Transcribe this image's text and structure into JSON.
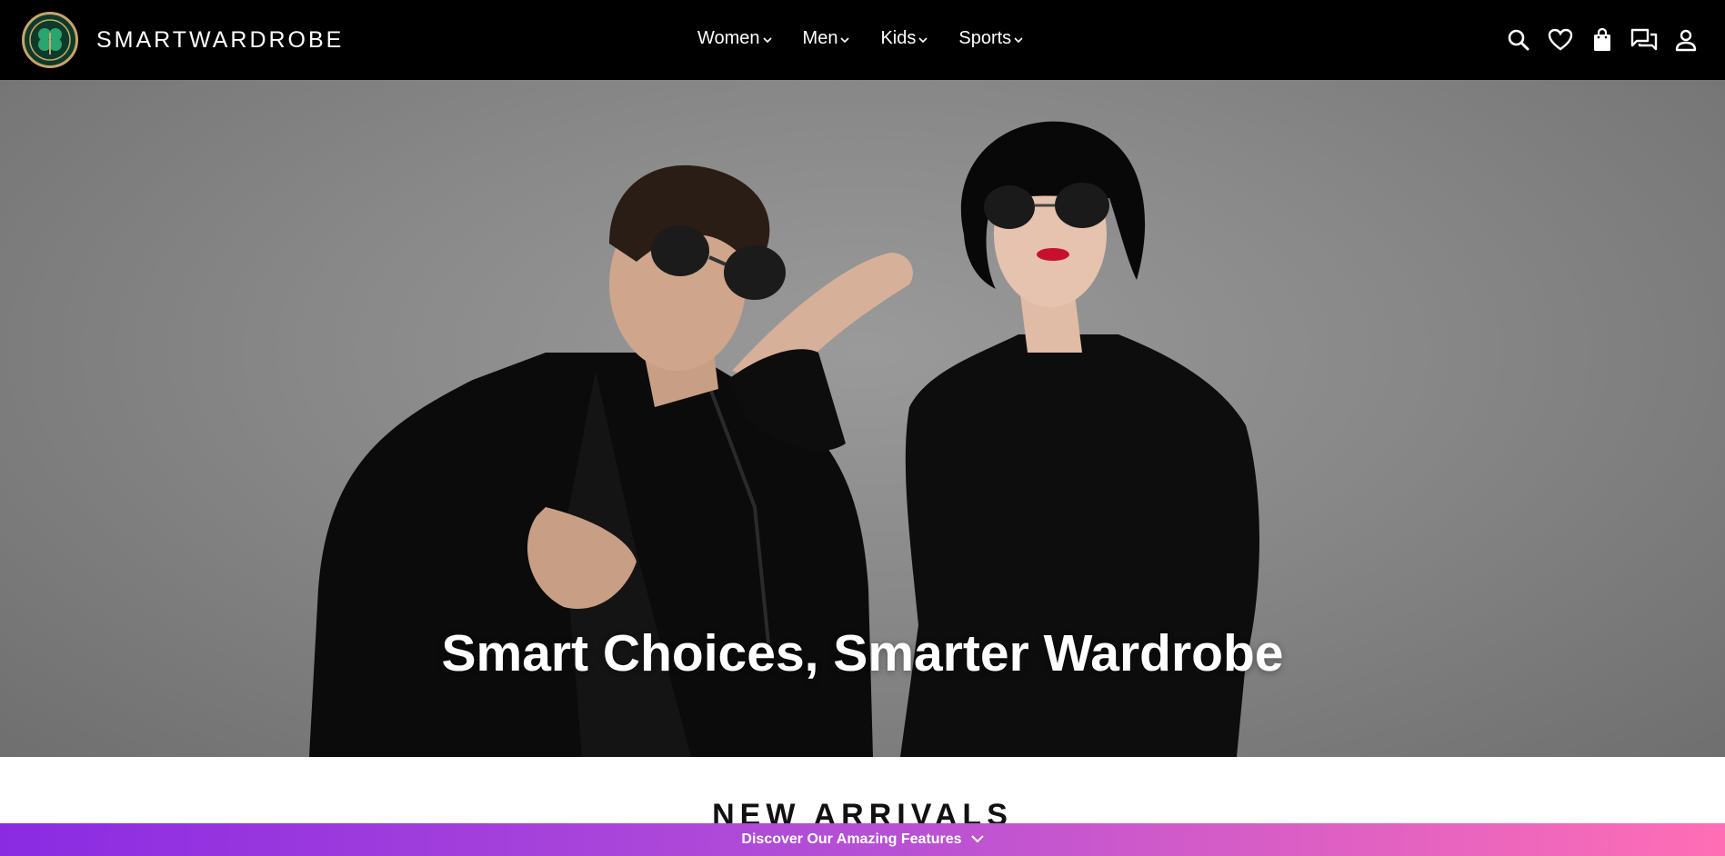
{
  "header": {
    "brand": "SMARTWARDROBE",
    "logo_icon": "clover-crest-logo",
    "nav": [
      {
        "label": "Women"
      },
      {
        "label": "Men"
      },
      {
        "label": "Kids"
      },
      {
        "label": "Sports"
      }
    ],
    "icons": [
      "search-icon",
      "heart-icon",
      "bag-icon",
      "chat-icon",
      "user-icon"
    ]
  },
  "hero": {
    "title": "Smart Choices, Smarter Wardrobe",
    "image": "hero-photo-couple-black-outfits-sunglasses"
  },
  "sections": {
    "new_arrivals_title": "NEW ARRIVALS"
  },
  "promo_bar": {
    "label": "Discover Our Amazing Features"
  },
  "colors": {
    "header_bg": "#000000",
    "promo_start": "#8a2be2",
    "promo_end": "#ff6eb4",
    "logo_green": "#0d3b2a",
    "logo_gold": "#c9a46a"
  }
}
